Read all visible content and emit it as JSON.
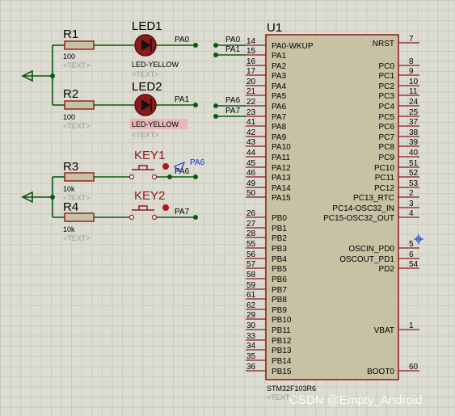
{
  "mcu": {
    "ref": "U1",
    "part": "STM32F103R6",
    "text_placeholder": "<TEXT>",
    "left_pins": [
      {
        "num": "14",
        "name": "PA0-WKUP"
      },
      {
        "num": "15",
        "name": "PA1"
      },
      {
        "num": "16",
        "name": "PA2"
      },
      {
        "num": "17",
        "name": "PA3"
      },
      {
        "num": "20",
        "name": "PA4"
      },
      {
        "num": "21",
        "name": "PA5"
      },
      {
        "num": "22",
        "name": "PA6"
      },
      {
        "num": "23",
        "name": "PA7"
      },
      {
        "num": "41",
        "name": "PA8"
      },
      {
        "num": "42",
        "name": "PA9"
      },
      {
        "num": "43",
        "name": "PA10"
      },
      {
        "num": "44",
        "name": "PA11"
      },
      {
        "num": "45",
        "name": "PA12"
      },
      {
        "num": "46",
        "name": "PA13"
      },
      {
        "num": "49",
        "name": "PA14"
      },
      {
        "num": "50",
        "name": "PA15"
      },
      {
        "num": "26",
        "name": "PB0"
      },
      {
        "num": "27",
        "name": "PB1"
      },
      {
        "num": "28",
        "name": "PB2"
      },
      {
        "num": "55",
        "name": "PB3"
      },
      {
        "num": "56",
        "name": "PB4"
      },
      {
        "num": "57",
        "name": "PB5"
      },
      {
        "num": "58",
        "name": "PB6"
      },
      {
        "num": "59",
        "name": "PB7"
      },
      {
        "num": "61",
        "name": "PB8"
      },
      {
        "num": "62",
        "name": "PB9"
      },
      {
        "num": "29",
        "name": "PB10"
      },
      {
        "num": "30",
        "name": "PB11"
      },
      {
        "num": "33",
        "name": "PB12"
      },
      {
        "num": "34",
        "name": "PB13"
      },
      {
        "num": "35",
        "name": "PB14"
      },
      {
        "num": "36",
        "name": "PB15"
      }
    ],
    "right_pins": [
      {
        "num": "7",
        "name": "NRST"
      },
      {
        "num": "8",
        "name": "PC0"
      },
      {
        "num": "9",
        "name": "PC1"
      },
      {
        "num": "10",
        "name": "PC2"
      },
      {
        "num": "11",
        "name": "PC3"
      },
      {
        "num": "24",
        "name": "PC4"
      },
      {
        "num": "25",
        "name": "PC5"
      },
      {
        "num": "37",
        "name": "PC6"
      },
      {
        "num": "38",
        "name": "PC7"
      },
      {
        "num": "39",
        "name": "PC8"
      },
      {
        "num": "40",
        "name": "PC9"
      },
      {
        "num": "51",
        "name": "PC10"
      },
      {
        "num": "52",
        "name": "PC11"
      },
      {
        "num": "53",
        "name": "PC12"
      },
      {
        "num": "2",
        "name": "PC13_RTC"
      },
      {
        "num": "3",
        "name": "PC14-OSC32_IN"
      },
      {
        "num": "4",
        "name": "PC15-OSC32_OUT"
      },
      {
        "num": "5",
        "name": "OSCIN_PD0"
      },
      {
        "num": "6",
        "name": "OSCOUT_PD1"
      },
      {
        "num": "54",
        "name": "PD2"
      },
      {
        "num": "1",
        "name": "VBAT"
      },
      {
        "num": "60",
        "name": "BOOT0"
      }
    ]
  },
  "net_labels": {
    "pa0_wire": "PA0",
    "pa1_wire": "PA1",
    "pa6_wire": "PA6",
    "pa7_wire": "PA7",
    "led1_net": "PA0",
    "led2_net": "PA1",
    "key1_net": "PA6",
    "key2_net": "PA7",
    "probe": "PA6"
  },
  "components": {
    "r1": {
      "ref": "R1",
      "value": "100",
      "text": "<TEXT>"
    },
    "r2": {
      "ref": "R2",
      "value": "100",
      "text": "<TEXT>"
    },
    "r3": {
      "ref": "R3",
      "value": "10k",
      "text": "<TEXT>"
    },
    "r4": {
      "ref": "R4",
      "value": "10k",
      "text": "<TEXT>"
    },
    "led1": {
      "ref": "LED1",
      "part": "LED-YELLOW",
      "text": "<TEXT>"
    },
    "led2": {
      "ref": "LED2",
      "part": "LED-YELLOW",
      "text": "<TEXT>"
    },
    "key1": {
      "ref": "KEY1"
    },
    "key2": {
      "ref": "KEY2"
    }
  },
  "watermark": "CSDN @Empty_Android",
  "colors": {
    "background": "#dcdcd2",
    "wire": "#0b5a0b",
    "component_outline": "#8b1a1a",
    "component_fill": "#c8c2a5",
    "probe": "#1a33cc"
  }
}
